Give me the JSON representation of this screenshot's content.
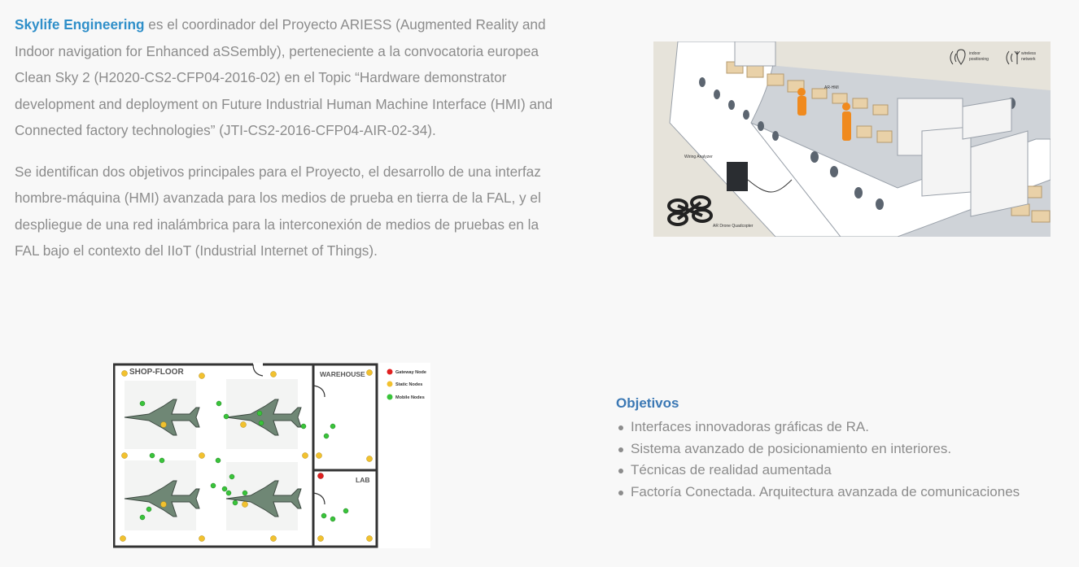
{
  "intro": {
    "brand": "Skylife Engineering",
    "paragraph1_rest": " es el coordinador del Proyecto ARIESS (Augmented Reality and Indoor navigation for Enhanced aSSembly), perteneciente a la convocatoria europea Clean Sky 2 (H2020-CS2-CFP04-2016-02) en el Topic “Hardware demonstrator development and deployment on Future Industrial Human Machine Interface (HMI) and Connected factory technologies” (JTI-CS2-2016-CFP04-AIR-02-34).",
    "paragraph2": "Se identifican dos objetivos principales para el Proyecto, el desarrollo de una interfaz hombre-máquina (HMI) avanzada para los medios de prueba en tierra de la FAL, y el despliegue de una red inalámbrica para la interconexión de medios de pruebas en la FAL bajo el contexto del IIoT (Industrial Internet of Things)."
  },
  "hero_image": {
    "label_air_hmi": "AR-HMI",
    "label_wiring": "Wiring Analyzer",
    "label_drone": "AR Drone Quadcopter",
    "label_indoor": [
      "indoor",
      "positioning"
    ],
    "label_wireless": [
      "wireless",
      "network"
    ]
  },
  "floor_plan": {
    "shop_floor": "SHOP-FLOOR",
    "warehouse": "WAREHOUSE",
    "lab": "LAB",
    "legend": [
      {
        "label": "Gateway Node",
        "color": "#e02020"
      },
      {
        "label": "Static Nodes",
        "color": "#f2c12e"
      },
      {
        "label": "Mobile Nodes",
        "color": "#39c43a"
      }
    ]
  },
  "objectives": {
    "title": "Objetivos",
    "items": [
      "Interfaces innovadoras gráficas de RA.",
      "Sistema avanzado de posicionamiento en interiores.",
      "Técnicas de realidad aumentada",
      "Factoría Conectada. Arquitectura avanzada de comunicaciones"
    ]
  }
}
